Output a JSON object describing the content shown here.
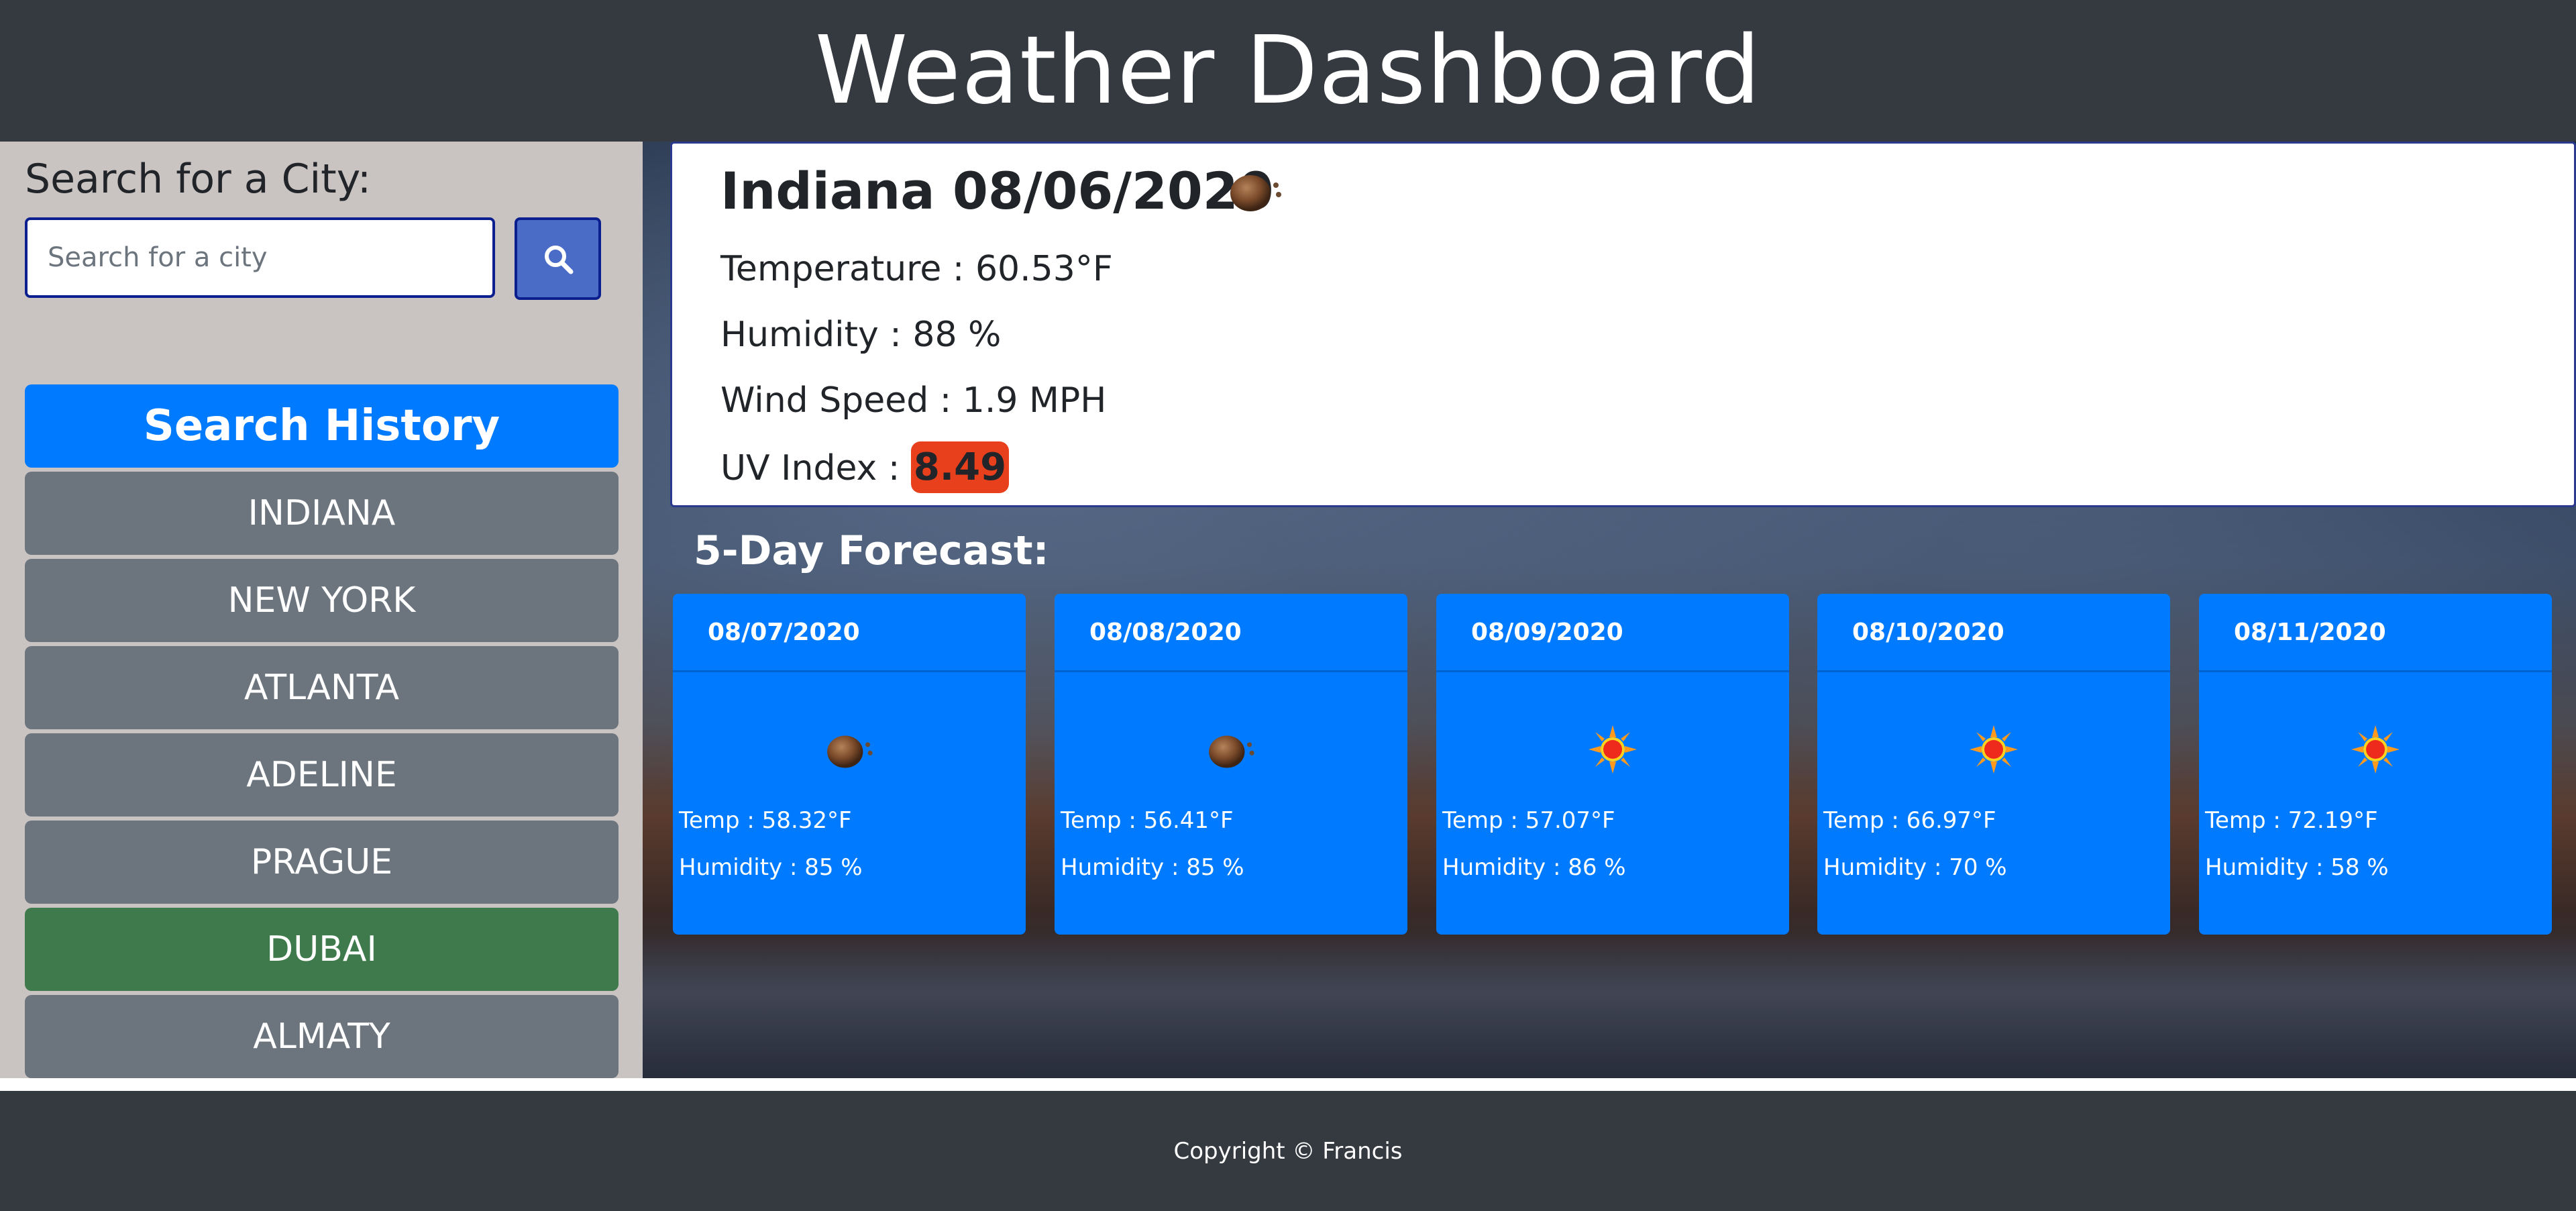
{
  "header": {
    "title": "Weather Dashboard"
  },
  "search": {
    "label": "Search for a City:",
    "placeholder": "Search for a city",
    "value": "",
    "button_icon": "search-icon"
  },
  "history": {
    "title": "Search History",
    "items": [
      {
        "label": "INDIANA",
        "active": false
      },
      {
        "label": "NEW YORK",
        "active": false
      },
      {
        "label": "ATLANTA",
        "active": false
      },
      {
        "label": "ADELINE",
        "active": false
      },
      {
        "label": "PRAGUE",
        "active": false
      },
      {
        "label": "DUBAI",
        "active": true
      },
      {
        "label": "ALMATY",
        "active": false
      }
    ]
  },
  "current": {
    "title": "Indiana 08/06/2020",
    "icon": "rain-cloud-icon",
    "temperature": "Temperature : 60.53°F",
    "humidity": "Humidity : 88 %",
    "wind": "Wind Speed : 1.9 MPH",
    "uv_label": "UV Index : ",
    "uv_value": "8.49",
    "uv_color": "#e8401c"
  },
  "forecast": {
    "title": "5-Day Forecast:",
    "days": [
      {
        "date": "08/07/2020",
        "icon": "rain-cloud-icon",
        "temp": "Temp : 58.32°F",
        "humidity": "Humidity : 85 %"
      },
      {
        "date": "08/08/2020",
        "icon": "rain-cloud-icon",
        "temp": "Temp : 56.41°F",
        "humidity": "Humidity : 85 %"
      },
      {
        "date": "08/09/2020",
        "icon": "sun-icon",
        "temp": "Temp : 57.07°F",
        "humidity": "Humidity : 86 %"
      },
      {
        "date": "08/10/2020",
        "icon": "sun-icon",
        "temp": "Temp : 66.97°F",
        "humidity": "Humidity : 70 %"
      },
      {
        "date": "08/11/2020",
        "icon": "sun-icon",
        "temp": "Temp : 72.19°F",
        "humidity": "Humidity : 58 %"
      }
    ]
  },
  "footer": {
    "text": "Copyright © Francis"
  },
  "colors": {
    "header_bg": "#343a40",
    "primary": "#007bff",
    "history_item": "#6c757d",
    "history_active": "#3e7a4c",
    "sidebar_bg": "#c9c3c2"
  }
}
